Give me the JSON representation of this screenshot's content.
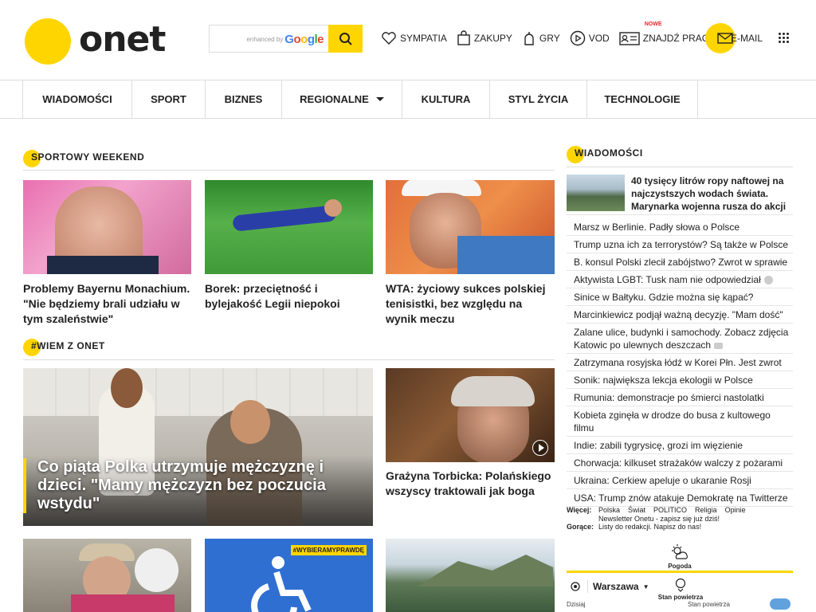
{
  "header": {
    "logo_text": "onet",
    "search_hint": "enhanced by",
    "search_brand": "Google",
    "nav": [
      {
        "label": "SYMPATIA",
        "icon": "heart-icon"
      },
      {
        "label": "ZAKUPY",
        "icon": "shopping-bag-icon"
      },
      {
        "label": "GRY",
        "icon": "gamepad-icon"
      },
      {
        "label": "VOD",
        "icon": "play-circle-icon"
      },
      {
        "label": "ZNAJDŹ PRACĘ",
        "icon": "id-card-icon",
        "badge": "NOWE"
      }
    ],
    "email_label": "E-MAIL",
    "accent_color": "#ffd500",
    "badge_color": "#e3262f"
  },
  "categories": [
    "WIADOMOŚCI",
    "SPORT",
    "BIZNES",
    "REGIONALNE",
    "KULTURA",
    "STYL ŻYCIA",
    "TECHNOLOGIE"
  ],
  "sections": {
    "sport": {
      "title": "SPORTOWY WEEKEND",
      "cards": [
        {
          "title": "Problemy Bayernu Monachium. \"Nie będziemy brali udziału w tym szaleństwie\""
        },
        {
          "title": "Borek: przeciętność i bylejakość Legii niepokoi"
        },
        {
          "title": "WTA: życiowy sukces polskiej tenisistki, bez względu na wynik meczu"
        }
      ]
    },
    "wiem": {
      "title": "#WIEM Z ONET",
      "feature_title": "Co piąta Polka utrzymuje mężczyznę i dzieci. \"Mamy mężczyzn bez poczucia wstydu\"",
      "side_title": "Grażyna Torbicka: Polańskiego wszyscy traktowali jak boga",
      "badge": "#WYBIERAMYPRAWDĘ"
    }
  },
  "news": {
    "title": "WIADOMOŚCI",
    "top": "40 tysięcy litrów ropy naftowej na najczystszych wodach świata. Marynarka wojenna rusza do akcji",
    "items": [
      {
        "text": "Marsz w Berlinie. Padły słowa o Polsce"
      },
      {
        "text": "Trump uzna ich za terrorystów? Są także w Polsce"
      },
      {
        "text": "B. konsul Polski zlecił zabójstwo? Zwrot w sprawie"
      },
      {
        "text": "Aktywista LGBT: Tusk nam nie odpowiedział",
        "media": "video"
      },
      {
        "text": "Sinice w Bałtyku. Gdzie można się kąpać?"
      },
      {
        "text": "Marcinkiewicz podjął ważną decyzję. \"Mam dość\""
      },
      {
        "text": "Zalane ulice, budynki i samochody. Zobacz zdjęcia Katowic po ulewnych deszczach",
        "media": "photo"
      },
      {
        "text": "Zatrzymana rosyjska łódź w Korei Płn. Jest zwrot"
      },
      {
        "text": "Sonik: największa lekcja ekologii w Polsce"
      },
      {
        "text": "Rumunia: demonstracje po śmierci nastolatki"
      },
      {
        "text": "Kobieta zginęła w drodze do busa z kultowego filmu"
      },
      {
        "text": "Indie: zabili tygrysicę, grozi im więzienie"
      },
      {
        "text": "Chorwacja: kilkuset strażaków walczy z pożarami"
      },
      {
        "text": "Ukraina: Cerkiew apeluje o ukaranie Rosji"
      },
      {
        "text": "USA: Trump znów atakuje Demokratę na Twitterze"
      }
    ],
    "more_label": "Więcej:",
    "more_links": [
      "Polska",
      "Świat",
      "POLITICO",
      "Religia",
      "Opinie"
    ],
    "newsletter": "Newsletter Onetu - zapisz się już dziś!",
    "hot_label": "Gorące:",
    "hot_text": "Listy do redakcji. Napisz do nas!"
  },
  "weather": {
    "label": "Pogoda",
    "city": "Warszawa",
    "air_label": "Stan powietrza",
    "today": "Dzisiaj",
    "air_status": "Stan powietrza"
  }
}
